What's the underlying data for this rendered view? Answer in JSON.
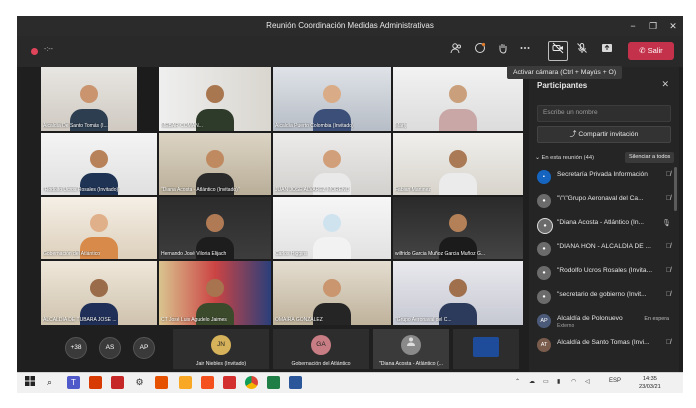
{
  "window": {
    "title": "Reunión Coordinación Medidas Administrativas",
    "controls": [
      "−",
      "❐",
      "✕"
    ]
  },
  "toolbar": {
    "timer": "-:--",
    "icons": [
      "people-icon",
      "reaction-icon",
      "raise-hand-icon",
      "more-icon",
      "camera-off-icon",
      "mic-off-icon",
      "share-tray-icon"
    ],
    "leave_label": "Salir",
    "tooltip": "Activar cámara (Ctrl + Mayús + O)",
    "accent": "#c4314b"
  },
  "video_tiles": [
    {
      "caption": "Alcaldía De Santo Tomás (I..."
    },
    {
      "caption": "MEBAR COMAN..."
    },
    {
      "caption": "Alcaldía Puerto Colombia (Invitado)"
    },
    {
      "caption": "Marly"
    },
    {
      "caption": "\"Rodolfo Ucros Rosales (Invitado)\""
    },
    {
      "caption": "\"Diana Acosta - Atlántico (Invitado)\""
    },
    {
      "caption": "JUAN JOSE ALVAREZ MORENO"
    },
    {
      "caption": "Fabian Martinez"
    },
    {
      "caption": "Gobernación del Atlántico"
    },
    {
      "caption": "Hernando José Viloria Elijach"
    },
    {
      "caption": "Carlos Higgins"
    },
    {
      "caption": "wilfrido Garcia Muñoz Garcia Muñoz G..."
    },
    {
      "caption": "ALCALDIA DE TUBARA JOSE ..."
    },
    {
      "caption": "CT José Luis Agudelo Jaimes"
    },
    {
      "caption": "OMAIRA GONZALEZ"
    },
    {
      "caption": "\"Grupo Aeronaval del C..."
    }
  ],
  "callbar": {
    "overflow": "+38",
    "avatars": [
      {
        "initials": "AS",
        "color": "#3a3a3a"
      },
      {
        "initials": "AP",
        "color": "#3a3a3a"
      }
    ],
    "mini_tiles": [
      {
        "initials": "JN",
        "name": "Jair Niebles (Invitado)",
        "color": "#d6b25a"
      },
      {
        "initials": "GA",
        "name": "Gobernación del Atlántico",
        "color": "#c77d83"
      },
      {
        "initials": "",
        "name": "\"Diana Acosta - Atlántico (...",
        "color": "#8a8a8a"
      },
      {
        "initials": "",
        "name": "",
        "color": "#2d2d2d"
      }
    ]
  },
  "participants": {
    "title": "Participantes",
    "search_placeholder": "Escribe un nombre",
    "share_label": "Compartir invitación",
    "section_label": "En esta reunión (44)",
    "mute_all_label": "Silenciar a todos",
    "rows": [
      {
        "name": "Secretaría Privada Información",
        "sub": "",
        "state": "muted"
      },
      {
        "name": "\"\\\"\\\"Grupo Aeronaval del Ca...",
        "sub": "",
        "state": "muted"
      },
      {
        "name": "\"Diana Acosta - Atlántico (In...",
        "sub": "",
        "state": "mic"
      },
      {
        "name": "\"DIANA HON - ALCALDÍA DE ...",
        "sub": "",
        "state": "muted"
      },
      {
        "name": "\"Rodolfo Ucros Rosales (Invita...",
        "sub": "",
        "state": "muted"
      },
      {
        "name": "\"secretario de gobierno (Invit...",
        "sub": "",
        "state": "muted"
      },
      {
        "name": "Alcaldía de Polonuevo",
        "sub": "Externo",
        "state": "En espera",
        "initials": "AP"
      },
      {
        "name": "Alcaldía de Santo Tomas (Invi...",
        "sub": "",
        "state": "muted",
        "initials": "AT"
      }
    ]
  },
  "taskbar": {
    "apps": [
      "windows-icon",
      "search-icon",
      "teams-icon",
      "office-icon",
      "app-red-icon",
      "settings-icon",
      "app-orange-icon",
      "paint-icon",
      "word-icon",
      "pdf-icon",
      "chrome-icon",
      "excel-icon",
      "word2-icon"
    ],
    "language": "ESP",
    "time": "14:35",
    "date": "23/03/21"
  }
}
